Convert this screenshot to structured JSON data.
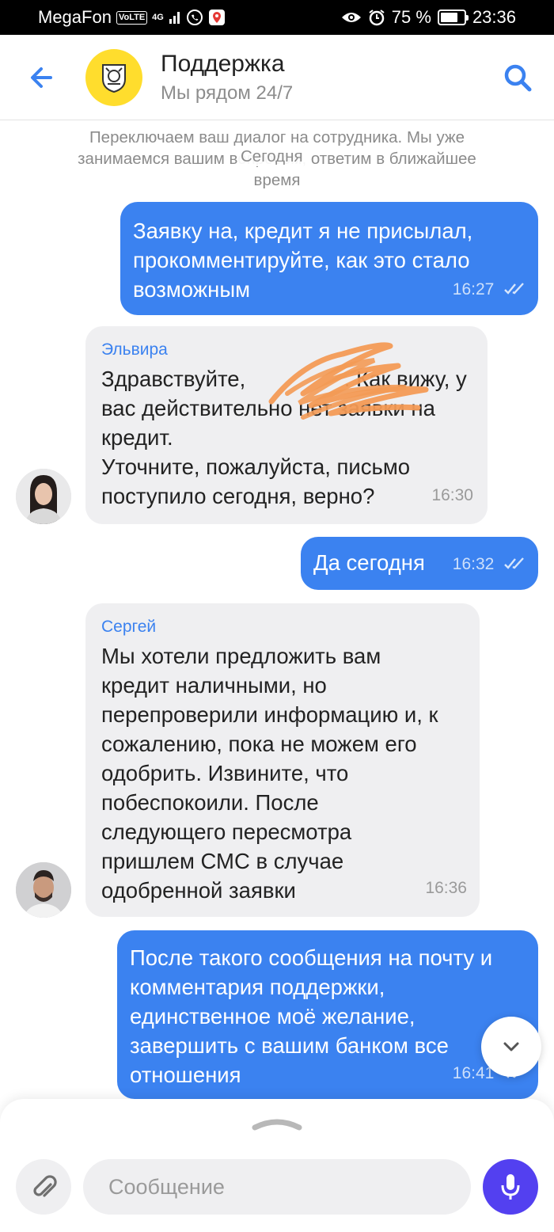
{
  "status_bar": {
    "carrier": "MegaFon",
    "volte": "VoLTE",
    "network": "4G",
    "battery": "75 %",
    "battery_level": 0.75,
    "time": "23:36"
  },
  "header": {
    "title": "Поддержка",
    "subtitle": "Мы рядом 24/7"
  },
  "system_message": {
    "text": "Переключаем ваш диалог на сотрудника. Мы уже занимаемся вашим вопросом, ответим в ближайшее время",
    "date_chip": "Сегодня"
  },
  "messages": [
    {
      "text": "Заявку на, кредит я не присылал, прокомментируйте, как это стало возможным",
      "time": "16:27"
    },
    {
      "sender": "Эльвира",
      "text": "Здравствуйте, ██████. Как вижу, у вас действительно нет заявки на кредит.\nУточните, пожалуйста, письмо поступило сегодня, верно?",
      "time": "16:30"
    },
    {
      "text": "Да сегодня",
      "time": "16:32"
    },
    {
      "sender": "Сергей",
      "text": "Мы хотели предложить вам кредит наличными, но перепроверили информацию и, к сожалению, пока не можем его одобрить. Извините, что побеспокоили. После следующего пересмотра пришлем СМС в случае одобренной заявки",
      "time": "16:36"
    },
    {
      "text": "После такого сообщения на почту и комментария поддержки, единственное моё желание, завершить с вашим банком все отношения",
      "time": "16:41"
    }
  ],
  "input": {
    "placeholder": "Сообщение"
  },
  "colors": {
    "accent": "#3b82f0",
    "brand_yellow": "#ffdd2d",
    "mic": "#5340f0"
  },
  "icons": [
    "back-arrow-icon",
    "bank-logo-icon",
    "search-icon",
    "double-check-icon",
    "scroll-down-icon",
    "collapse-handle-icon",
    "paperclip-icon",
    "microphone-icon"
  ]
}
